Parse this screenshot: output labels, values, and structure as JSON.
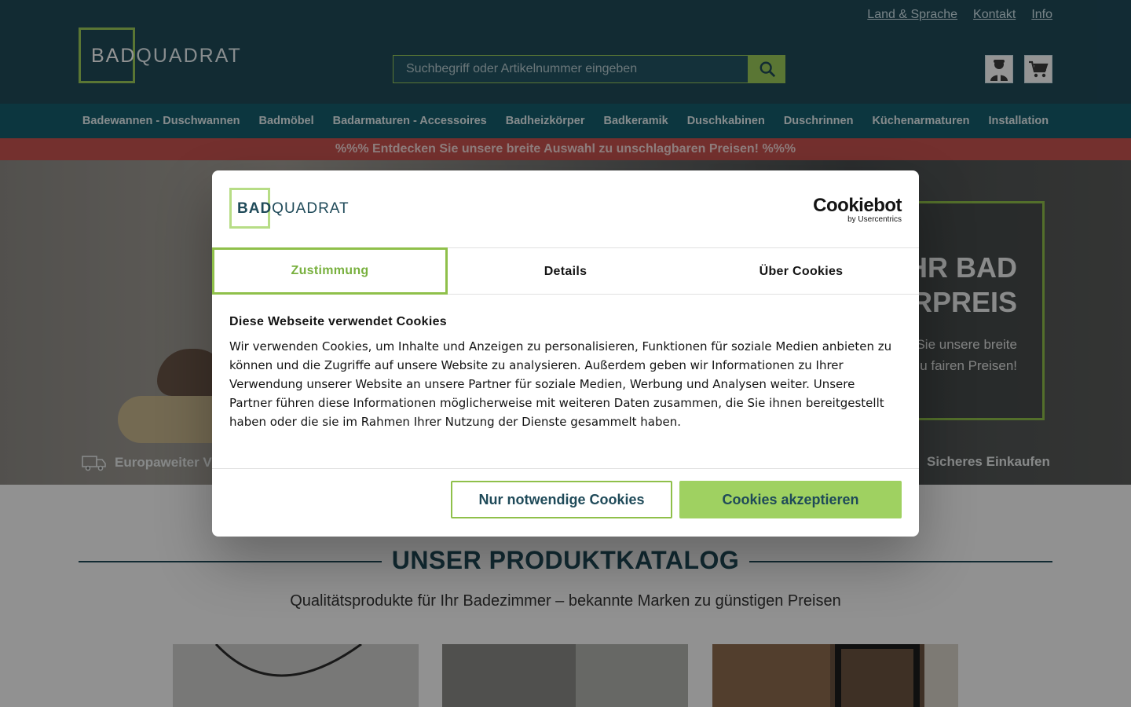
{
  "header": {
    "top_links": [
      "Land & Sprache",
      "Kontakt",
      "Info"
    ],
    "logo": {
      "left": "BAD",
      "right": "QUADRAT"
    },
    "search": {
      "placeholder": "Suchbegriff oder Artikelnummer eingeben",
      "icon": "search-icon"
    },
    "account_icon": "user-icon",
    "cart_icon": "cart-icon"
  },
  "nav": {
    "items": [
      "Badewannen - Duschwannen",
      "Badmöbel",
      "Badarmaturen - Accessoires",
      "Badheizkörper",
      "Badkeramik",
      "Duschkabinen",
      "Duschrinnen",
      "Küchenarmaturen",
      "Installation"
    ]
  },
  "promo": "%%% Entdecken Sie unsere breite Auswahl zu unschlagbaren Preisen! %%%",
  "hero": {
    "headline_lines": [
      "HR BAD",
      "ARPREIS"
    ],
    "text_lines": [
      "Sie unsere breite",
      "u fairen Preisen!"
    ],
    "usp_left": "Europaweiter V",
    "usp_right": "Sicheres Einkaufen"
  },
  "catalog": {
    "title": "UNSER PRODUKTKATALOG",
    "subtitle": "Qualitätsprodukte für Ihr Badezimmer – bekannte Marken zu günstigen Preisen"
  },
  "cookie_modal": {
    "logo": {
      "left": "BAD",
      "right": "QUADRAT"
    },
    "provider": {
      "name": "Cookiebot",
      "by": "by Usercentrics"
    },
    "tabs": [
      "Zustimmung",
      "Details",
      "Über Cookies"
    ],
    "heading": "Diese Webseite verwendet Cookies",
    "body": "Wir verwenden Cookies, um Inhalte und Anzeigen zu personalisieren, Funktionen für soziale Medien anbieten zu können und die Zugriffe auf unsere Website zu analysieren. Außerdem geben wir Informationen zu Ihrer Verwendung unserer Website an unsere Partner für soziale Medien, Werbung und Analysen weiter. Unsere Partner führen diese Informationen möglicherweise mit weiteren Daten zusammen, die Sie ihnen bereitgestellt haben oder die sie im Rahmen Ihrer Nutzung der Dienste gesammelt haben.",
    "btn_necessary": "Nur notwendige Cookies",
    "btn_accept": "Cookies akzeptieren"
  },
  "colors": {
    "header_bg": "#1f4a59",
    "nav_bg": "#155d6d",
    "promo_bg": "#c85350",
    "accent_green": "#8fc04a",
    "accept_bg": "#9fd161"
  }
}
